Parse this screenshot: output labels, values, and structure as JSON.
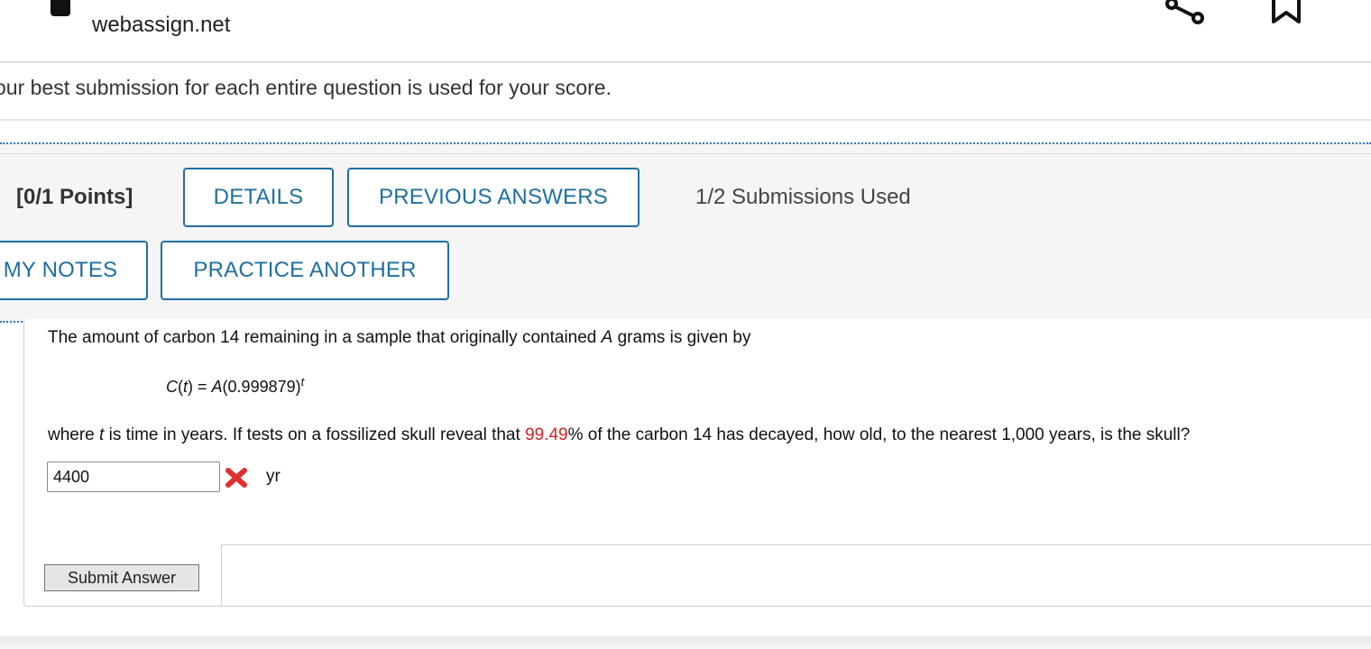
{
  "browser": {
    "domain": "webassign.net",
    "icons": [
      "lock-icon",
      "share-icon",
      "bookmark-icon"
    ]
  },
  "notice": {
    "text": "our best submission for each entire question is used for your score."
  },
  "question_header": {
    "points": "[0/1 Points]",
    "details_label": "DETAILS",
    "previous_answers_label": "PREVIOUS ANSWERS",
    "submissions": "1/2 Submissions Used",
    "my_notes_label": "MY NOTES",
    "practice_another_label": "PRACTICE ANOTHER"
  },
  "question": {
    "intro_before": "The amount of carbon 14 remaining in a sample that originally contained ",
    "intro_var": "A",
    "intro_after": " grams is given by",
    "formula_lhs_fn": "C",
    "formula_lhs_var": "t",
    "formula_eq": " = ",
    "formula_coeff": "A",
    "formula_base": "(0.999879)",
    "formula_exp": "t",
    "q_before": "where ",
    "q_var": "t",
    "q_mid": " is time in years. If tests on a fossilized skull reveal that ",
    "q_highlight": "99.49",
    "q_after": "% of the carbon 14 has decayed, how old, to the nearest 1,000 years, is the skull?",
    "answer_value": "4400",
    "answer_status": "incorrect",
    "unit": "yr",
    "submit_label": "Submit Answer"
  },
  "colors": {
    "accent": "#1e6f9f",
    "highlight": "#d42020",
    "wrong": "#e03030"
  }
}
